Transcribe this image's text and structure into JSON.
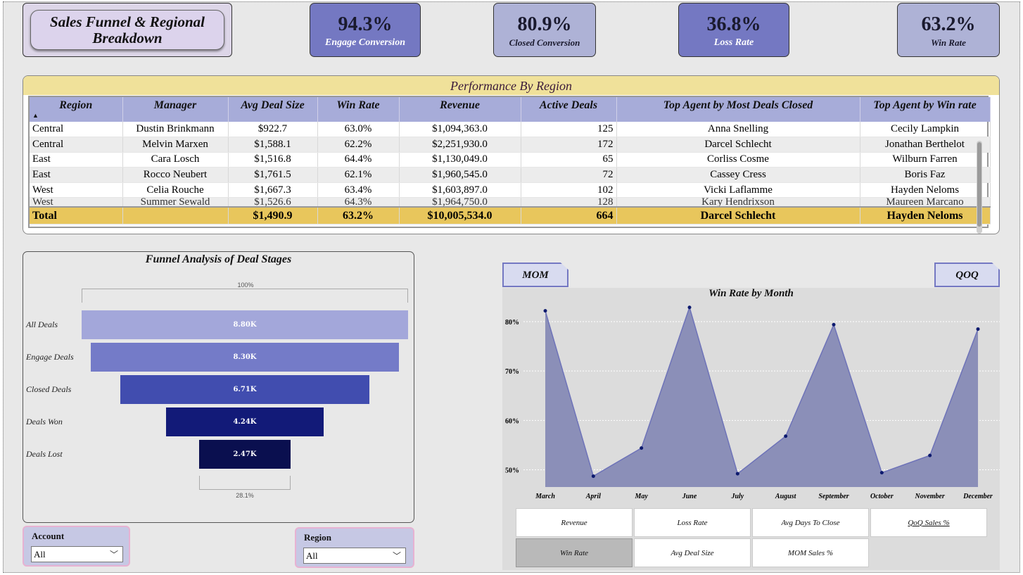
{
  "header": {
    "title_line1": "Sales Funnel & Regional",
    "title_line2": "Breakdown"
  },
  "kpis": [
    {
      "value": "94.3%",
      "label": "Engage Conversion"
    },
    {
      "value": "80.9%",
      "label": "Closed Conversion"
    },
    {
      "value": "36.8%",
      "label": "Loss Rate"
    },
    {
      "value": "63.2%",
      "label": "Win Rate"
    }
  ],
  "performance": {
    "title": "Performance By Region",
    "columns": [
      "Region",
      "Manager",
      "Avg Deal Size",
      "Win Rate",
      "Revenue",
      "Active Deals",
      "Top Agent by Most Deals Closed",
      "Top Agent by Win rate"
    ],
    "rows": [
      [
        "Central",
        "Dustin Brinkmann",
        "$922.7",
        "63.0%",
        "$1,094,363.0",
        "125",
        "Anna Snelling",
        "Cecily Lampkin"
      ],
      [
        "Central",
        "Melvin Marxen",
        "$1,588.1",
        "62.2%",
        "$2,251,930.0",
        "172",
        "Darcel Schlecht",
        "Jonathan Berthelot"
      ],
      [
        "East",
        "Cara Losch",
        "$1,516.8",
        "64.4%",
        "$1,130,049.0",
        "65",
        "Corliss Cosme",
        "Wilburn Farren"
      ],
      [
        "East",
        "Rocco Neubert",
        "$1,761.5",
        "62.1%",
        "$1,960,545.0",
        "72",
        "Cassey Cress",
        "Boris Faz"
      ],
      [
        "West",
        "Celia Rouche",
        "$1,667.3",
        "63.4%",
        "$1,603,897.0",
        "102",
        "Vicki Laflamme",
        "Hayden Neloms"
      ],
      [
        "West",
        "Summer Sewald",
        "$1,526.6",
        "64.3%",
        "$1,964,750.0",
        "128",
        "Kary Hendrixson",
        "Maureen Marcano"
      ]
    ],
    "total": [
      "Total",
      "",
      "$1,490.9",
      "63.2%",
      "$10,005,534.0",
      "664",
      "Darcel Schlecht",
      "Hayden Neloms"
    ]
  },
  "funnel": {
    "title": "Funnel Analysis of Deal Stages",
    "top_pct": "100%",
    "bottom_pct": "28.1%",
    "stages": [
      {
        "label": "All Deals",
        "value_label": "8.80K",
        "value": 8800,
        "color": "#a3a7da"
      },
      {
        "label": "Engage Deals",
        "value_label": "8.30K",
        "value": 8300,
        "color": "#747bc8"
      },
      {
        "label": "Closed Deals",
        "value_label": "6.71K",
        "value": 6710,
        "color": "#414daf"
      },
      {
        "label": "Deals Won",
        "value_label": "4.24K",
        "value": 4240,
        "color": "#121a78"
      },
      {
        "label": "Deals Lost",
        "value_label": "2.47K",
        "value": 2470,
        "color": "#0a0f4f"
      }
    ]
  },
  "filters": {
    "account": {
      "label": "Account",
      "value": "All"
    },
    "region": {
      "label": "Region",
      "value": "All"
    }
  },
  "tabs": {
    "mom": "MOM",
    "qoq": "QOQ"
  },
  "chart_data": {
    "type": "area",
    "title": "Win Rate by Month",
    "categories": [
      "March",
      "April",
      "May",
      "June",
      "July",
      "August",
      "September",
      "October",
      "November",
      "December"
    ],
    "series": [
      {
        "values": [
          82.2,
          48.7,
          54.4,
          82.9,
          49.2,
          56.8,
          79.4,
          49.4,
          52.9,
          78.5
        ]
      }
    ],
    "y_ticks": [
      "80%",
      "70%",
      "60%",
      "50%"
    ],
    "ylim": [
      46.5,
      84
    ],
    "grid": "horizontal-dotted",
    "fill_color": "#8b8fb8",
    "line_color": "#6e73b8",
    "point_color": "#0d1a6e"
  },
  "measure_buttons": [
    {
      "label": "Revenue",
      "active": false
    },
    {
      "label": "Loss Rate",
      "active": false
    },
    {
      "label": "Avg Days To Close",
      "active": false
    },
    {
      "label": "QoQ Sales %",
      "active": false
    },
    {
      "label": "Win Rate",
      "active": true
    },
    {
      "label": "Avg Deal Size",
      "active": false
    },
    {
      "label": "MOM Sales %",
      "active": false
    }
  ]
}
